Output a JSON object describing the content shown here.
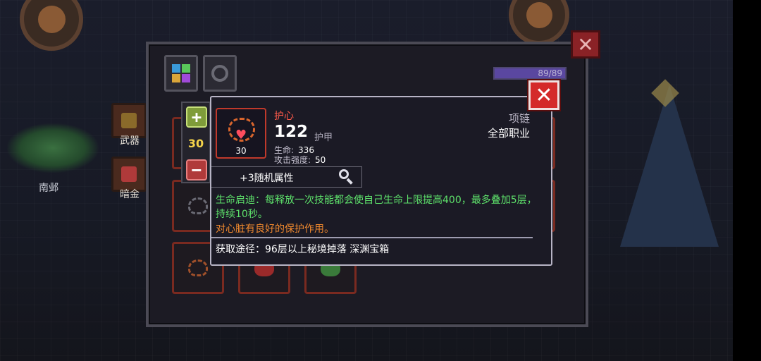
{
  "background": {
    "character_name": "南邺",
    "side_tabs": [
      {
        "label": "武器",
        "color": "#8a6a2a"
      },
      {
        "label": "暗金",
        "color": "#b03a3a"
      }
    ]
  },
  "inventory": {
    "capacity": "89/89",
    "capacity_fill": 1.0,
    "tabs": [
      {
        "name": "all-items",
        "icon": "grid-icon"
      },
      {
        "name": "accessories",
        "icon": "ring-icon"
      }
    ]
  },
  "stepper": {
    "plus": "+",
    "value": "30",
    "minus": "−"
  },
  "tooltip": {
    "item": {
      "name": "护心",
      "level": "30",
      "slot_type": "项链",
      "class_restriction": "全部职业",
      "main_stat_value": "122",
      "main_stat_label": "护甲",
      "sub_stats": [
        {
          "label": "生命:",
          "value": "336"
        },
        {
          "label": "攻击强度:",
          "value": "50"
        }
      ]
    },
    "random_attributes": "+3随机属性",
    "effect_text": "生命启迪：每释放一次技能都会使自己生命上限提高400，最多叠加5层，持续10秒。",
    "flavor_text": "对心脏有良好的保护作用。",
    "source_text": "获取途径：96层以上秘境掉落 深渊宝箱"
  },
  "colors": {
    "item_name": "#ff5a4a",
    "effect": "#5ee26b",
    "flavor": "#f0892e",
    "close_button": "#d42a2a"
  }
}
